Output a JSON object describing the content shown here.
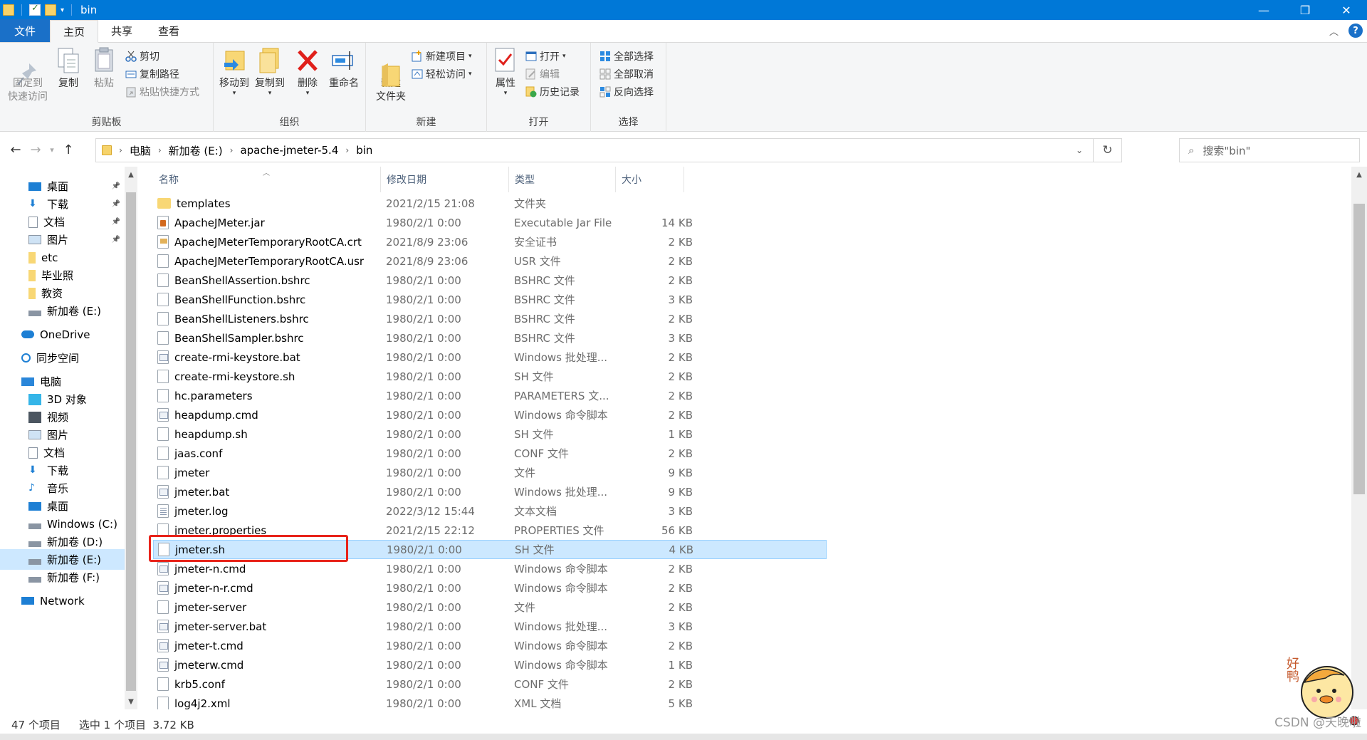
{
  "window": {
    "title": "bin",
    "controls": {
      "minimize": "—",
      "maximize": "❐",
      "close": "✕"
    }
  },
  "tabs": [
    "文件",
    "主页",
    "共享",
    "查看"
  ],
  "ribbon": {
    "clipboard": {
      "label": "剪贴板",
      "pin": "固定到\n快速访问",
      "copy": "复制",
      "paste": "粘贴",
      "cut": "剪切",
      "copy_path": "复制路径",
      "paste_shortcut": "粘贴快捷方式"
    },
    "organize": {
      "label": "组织",
      "move_to": "移动到",
      "copy_to": "复制到",
      "delete": "删除",
      "rename": "重命名"
    },
    "new": {
      "label": "新建",
      "new_folder": "新建\n文件夹",
      "new_item": "新建项目",
      "easy_access": "轻松访问"
    },
    "open": {
      "label": "打开",
      "properties": "属性",
      "open": "打开",
      "edit": "编辑",
      "history": "历史记录"
    },
    "select": {
      "label": "选择",
      "select_all": "全部选择",
      "select_none": "全部取消",
      "invert": "反向选择"
    }
  },
  "address": {
    "crumbs": [
      "电脑",
      "新加卷 (E:)",
      "apache-jmeter-5.4",
      "bin"
    ],
    "search_placeholder": "搜索\"bin\""
  },
  "nav": [
    {
      "label": "桌面",
      "icon": "desktop-icon",
      "pinned": true
    },
    {
      "label": "下载",
      "icon": "download-icon",
      "pinned": true
    },
    {
      "label": "文档",
      "icon": "document-icon",
      "pinned": true
    },
    {
      "label": "图片",
      "icon": "picture-icon",
      "pinned": true
    },
    {
      "label": "etc",
      "icon": "folder-icon"
    },
    {
      "label": "毕业照",
      "icon": "folder-icon"
    },
    {
      "label": "教资",
      "icon": "folder-icon"
    },
    {
      "label": "新加卷 (E:)",
      "icon": "drive-icon"
    },
    {
      "label": "OneDrive",
      "icon": "cloud-icon"
    },
    {
      "label": "同步空间",
      "icon": "sync-icon"
    },
    {
      "label": "电脑",
      "icon": "computer-icon"
    },
    {
      "label": "3D 对象",
      "icon": "cube-icon"
    },
    {
      "label": "视频",
      "icon": "video-icon"
    },
    {
      "label": "图片",
      "icon": "picture-icon"
    },
    {
      "label": "文档",
      "icon": "document-icon"
    },
    {
      "label": "下载",
      "icon": "download-icon"
    },
    {
      "label": "音乐",
      "icon": "music-icon"
    },
    {
      "label": "桌面",
      "icon": "desktop-icon"
    },
    {
      "label": "Windows (C:)",
      "icon": "drive-icon"
    },
    {
      "label": "新加卷 (D:)",
      "icon": "drive-icon"
    },
    {
      "label": "新加卷 (E:)",
      "icon": "drive-icon",
      "selected": true
    },
    {
      "label": "新加卷 (F:)",
      "icon": "drive-icon"
    },
    {
      "label": "Network",
      "icon": "network-icon"
    }
  ],
  "columns": {
    "name": "名称",
    "date": "修改日期",
    "type": "类型",
    "size": "大小"
  },
  "files": [
    {
      "name": "templates",
      "date": "2021/2/15 21:08",
      "type": "文件夹",
      "size": "",
      "icon": "folder"
    },
    {
      "name": "ApacheJMeter.jar",
      "date": "1980/2/1 0:00",
      "type": "Executable Jar File",
      "size": "14 KB",
      "icon": "jar"
    },
    {
      "name": "ApacheJMeterTemporaryRootCA.crt",
      "date": "2021/8/9 23:06",
      "type": "安全证书",
      "size": "2 KB",
      "icon": "cert"
    },
    {
      "name": "ApacheJMeterTemporaryRootCA.usr",
      "date": "2021/8/9 23:06",
      "type": "USR 文件",
      "size": "2 KB",
      "icon": "file"
    },
    {
      "name": "BeanShellAssertion.bshrc",
      "date": "1980/2/1 0:00",
      "type": "BSHRC 文件",
      "size": "2 KB",
      "icon": "file"
    },
    {
      "name": "BeanShellFunction.bshrc",
      "date": "1980/2/1 0:00",
      "type": "BSHRC 文件",
      "size": "3 KB",
      "icon": "file"
    },
    {
      "name": "BeanShellListeners.bshrc",
      "date": "1980/2/1 0:00",
      "type": "BSHRC 文件",
      "size": "2 KB",
      "icon": "file"
    },
    {
      "name": "BeanShellSampler.bshrc",
      "date": "1980/2/1 0:00",
      "type": "BSHRC 文件",
      "size": "3 KB",
      "icon": "file"
    },
    {
      "name": "create-rmi-keystore.bat",
      "date": "1980/2/1 0:00",
      "type": "Windows 批处理...",
      "size": "2 KB",
      "icon": "cmd"
    },
    {
      "name": "create-rmi-keystore.sh",
      "date": "1980/2/1 0:00",
      "type": "SH 文件",
      "size": "2 KB",
      "icon": "file"
    },
    {
      "name": "hc.parameters",
      "date": "1980/2/1 0:00",
      "type": "PARAMETERS 文...",
      "size": "2 KB",
      "icon": "file"
    },
    {
      "name": "heapdump.cmd",
      "date": "1980/2/1 0:00",
      "type": "Windows 命令脚本",
      "size": "2 KB",
      "icon": "cmd"
    },
    {
      "name": "heapdump.sh",
      "date": "1980/2/1 0:00",
      "type": "SH 文件",
      "size": "1 KB",
      "icon": "file"
    },
    {
      "name": "jaas.conf",
      "date": "1980/2/1 0:00",
      "type": "CONF 文件",
      "size": "2 KB",
      "icon": "file"
    },
    {
      "name": "jmeter",
      "date": "1980/2/1 0:00",
      "type": "文件",
      "size": "9 KB",
      "icon": "file"
    },
    {
      "name": "jmeter.bat",
      "date": "1980/2/1 0:00",
      "type": "Windows 批处理...",
      "size": "9 KB",
      "icon": "cmd"
    },
    {
      "name": "jmeter.log",
      "date": "2022/3/12 15:44",
      "type": "文本文档",
      "size": "3 KB",
      "icon": "log"
    },
    {
      "name": "jmeter.properties",
      "date": "2021/2/15 22:12",
      "type": "PROPERTIES 文件",
      "size": "56 KB",
      "icon": "file"
    },
    {
      "name": "jmeter.sh",
      "date": "1980/2/1 0:00",
      "type": "SH 文件",
      "size": "4 KB",
      "icon": "file",
      "selected": true
    },
    {
      "name": "jmeter-n.cmd",
      "date": "1980/2/1 0:00",
      "type": "Windows 命令脚本",
      "size": "2 KB",
      "icon": "cmd"
    },
    {
      "name": "jmeter-n-r.cmd",
      "date": "1980/2/1 0:00",
      "type": "Windows 命令脚本",
      "size": "2 KB",
      "icon": "cmd"
    },
    {
      "name": "jmeter-server",
      "date": "1980/2/1 0:00",
      "type": "文件",
      "size": "2 KB",
      "icon": "file"
    },
    {
      "name": "jmeter-server.bat",
      "date": "1980/2/1 0:00",
      "type": "Windows 批处理...",
      "size": "3 KB",
      "icon": "cmd"
    },
    {
      "name": "jmeter-t.cmd",
      "date": "1980/2/1 0:00",
      "type": "Windows 命令脚本",
      "size": "2 KB",
      "icon": "cmd"
    },
    {
      "name": "jmeterw.cmd",
      "date": "1980/2/1 0:00",
      "type": "Windows 命令脚本",
      "size": "1 KB",
      "icon": "cmd"
    },
    {
      "name": "krb5.conf",
      "date": "1980/2/1 0:00",
      "type": "CONF 文件",
      "size": "2 KB",
      "icon": "file"
    },
    {
      "name": "log4j2.xml",
      "date": "1980/2/1 0:00",
      "type": "XML 文档",
      "size": "5 KB",
      "icon": "file"
    }
  ],
  "status": {
    "count": "47 个项目",
    "selection": "选中 1 个项目  3.72 KB"
  },
  "watermark": "CSDN @天晚啦",
  "mascot_text": "好鸭",
  "colors": {
    "accent": "#0078d7",
    "selection": "#cce8ff",
    "highlight": "#e8231a"
  }
}
